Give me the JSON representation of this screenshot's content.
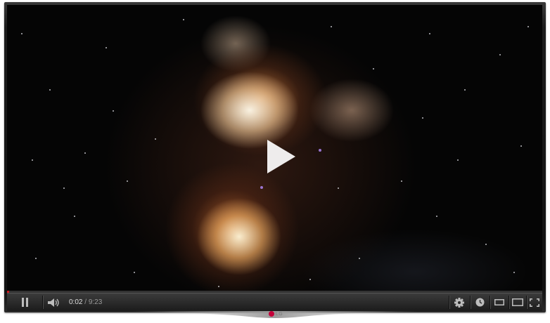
{
  "player": {
    "current_time": "0:02",
    "separator": "/",
    "duration": "9:23",
    "progress_fraction": 0.004
  },
  "controls": {
    "pause_icon": "pause-icon",
    "volume_icon": "volume-icon",
    "settings_icon": "gear-icon",
    "watch_later_icon": "clock-icon",
    "small_player_icon": "small-player-icon",
    "large_player_icon": "large-player-icon",
    "fullscreen_icon": "fullscreen-icon"
  },
  "overlay": {
    "play_icon": "play-icon"
  },
  "brand": {
    "logo_text": "LG",
    "logo_color": "#c4003a"
  },
  "colors": {
    "progress_fill": "#cc181e",
    "control_bar": "#1b1b1b"
  }
}
